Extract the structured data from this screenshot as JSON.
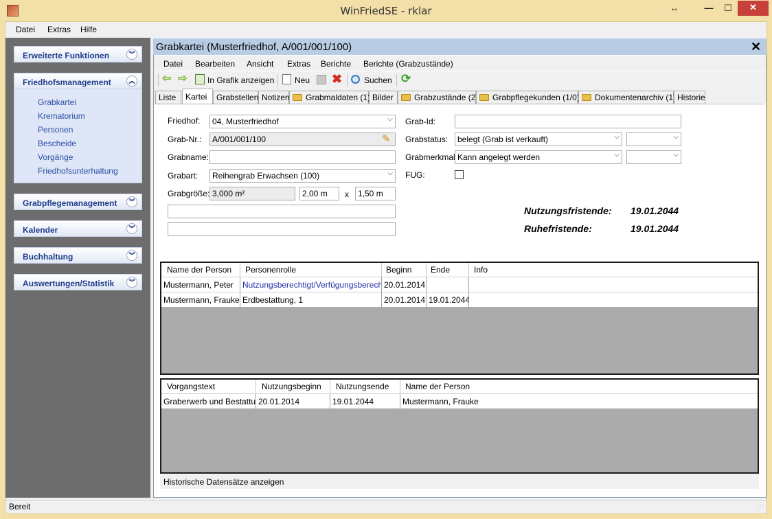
{
  "window": {
    "title": "WinFriedSE - rklar"
  },
  "menubar": {
    "items": [
      "Datei",
      "Extras",
      "Hilfe"
    ]
  },
  "sidebar": {
    "panels": [
      {
        "label": "Erweiterte Funktionen"
      },
      {
        "label": "Friedhofsmanagement"
      },
      {
        "label": "Grabpflegemanagement"
      },
      {
        "label": "Kalender"
      },
      {
        "label": "Buchhaltung"
      },
      {
        "label": "Auswertungen/Statistik"
      }
    ],
    "links": [
      "Grabkartei",
      "Krematorium",
      "Personen",
      "Bescheide",
      "Vorgänge",
      "Friedhofsunterhaltung"
    ]
  },
  "child": {
    "title": "Grabkartei (Musterfriedhof, A/001/001/100)",
    "menu": [
      "Datei",
      "Bearbeiten",
      "Ansicht",
      "Extras",
      "Berichte",
      "Berichte (Grabzustände)"
    ],
    "toolbar": {
      "show_graphic": "In Grafik anzeigen",
      "new": "Neu",
      "search": "Suchen"
    },
    "tabs": [
      "Liste",
      "Kartei",
      "Grabstellen",
      "Notizen",
      "Grabmaldaten (1)",
      "Bilder",
      "Grabzustände (2)",
      "Grabpflegekunden (1/0)",
      "Dokumentenarchiv (1)",
      "Historie"
    ]
  },
  "form": {
    "friedhof_label": "Friedhof:",
    "friedhof_value": "04, Musterfriedhof",
    "grabnr_label": "Grab-Nr.:",
    "grabnr_value": "A/001/001/100",
    "grabname_label": "Grabname:",
    "grabname_value": "",
    "grabart_label": "Grabart:",
    "grabart_value": "Reihengrab Erwachsen (100)",
    "grabgroesse_label": "Grabgröße:",
    "grabgroesse_area": "3,000 m²",
    "grabgroesse_w": "2,00 m",
    "grabgroesse_x": "x",
    "grabgroesse_h": "1,50 m",
    "grabid_label": "Grab-Id:",
    "grabid_value": "",
    "grabstatus_label": "Grabstatus:",
    "grabstatus_value": "belegt (Grab ist verkauft)",
    "grabmerkmal_label": "Grabmerkmal:",
    "grabmerkmal_value": "Kann angelegt werden",
    "fug_label": "FUG:",
    "nutzungsfristende_label": "Nutzungsfristende:",
    "nutzungsfristende_value": "19.01.2044",
    "ruhefristende_label": "Ruhefristende:",
    "ruhefristende_value": "19.01.2044"
  },
  "persons_grid": {
    "headers": [
      "Name der Person",
      "Personenrolle",
      "Beginn",
      "Ende",
      "Info"
    ],
    "rows": [
      [
        "Mustermann, Peter",
        "Nutzungsberechtigt/Verfügungsberechtigt",
        "20.01.2014",
        "",
        ""
      ],
      [
        "Mustermann, Frauke",
        "Erdbestattung, 1",
        "20.01.2014",
        "19.01.2044",
        ""
      ]
    ]
  },
  "process_grid": {
    "headers": [
      "Vorgangstext",
      "Nutzungsbeginn",
      "Nutzungsende",
      "Name der Person"
    ],
    "rows": [
      [
        "Graberwerb und Bestattung",
        "20.01.2014",
        "19.01.2044",
        "Mustermann, Frauke"
      ]
    ]
  },
  "history_checkbox": "Historische Datensätze anzeigen",
  "status": "Bereit",
  "colors": {
    "titlebar": "#f3dfa8",
    "sidebar": "#6d6d6d",
    "child_title": "#b8cde4",
    "link": "#2b4da3"
  }
}
